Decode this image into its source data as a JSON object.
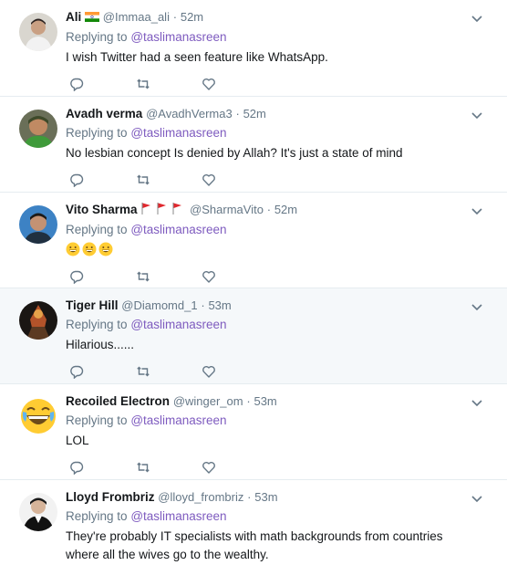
{
  "reply_prefix": "Replying to",
  "tweets": [
    {
      "name": "Ali",
      "flag": "india-flag",
      "handle": "@Immaa_ali",
      "dot": "·",
      "time": "52m",
      "mention": "@taslimanasreen",
      "text": "I wish Twitter had a seen feature like WhatsApp."
    },
    {
      "name": "Avadh verma",
      "handle": "@AvadhVerma3",
      "dot": "·",
      "time": "52m",
      "mention": "@taslimanasreen",
      "text": "No lesbian concept Is denied by Allah? It's just a state of mind"
    },
    {
      "name": "Vito Sharma",
      "handle": "@SharmaVito",
      "dot": "·",
      "time": "52m",
      "mention": "@taslimanasreen",
      "text": ""
    },
    {
      "name": "Tiger Hill",
      "handle": "@Diamomd_1",
      "dot": "·",
      "time": "53m",
      "mention": "@taslimanasreen",
      "text": "Hilarious......"
    },
    {
      "name": "Recoiled Electron",
      "handle": "@winger_om",
      "dot": "·",
      "time": "53m",
      "mention": "@taslimanasreen",
      "text": "LOL"
    },
    {
      "name": "Lloyd Frombriz",
      "handle": "@lloyd_frombriz",
      "dot": "·",
      "time": "53m",
      "mention": "@taslimanasreen",
      "text": "They're probably IT specialists with math backgrounds from countries where all the wives go to the wealthy."
    }
  ],
  "colors": {
    "mention": "#7e5bbf",
    "secondary": "#657786",
    "divider": "#e6ecf0",
    "highlight": "#f5f8fa"
  }
}
